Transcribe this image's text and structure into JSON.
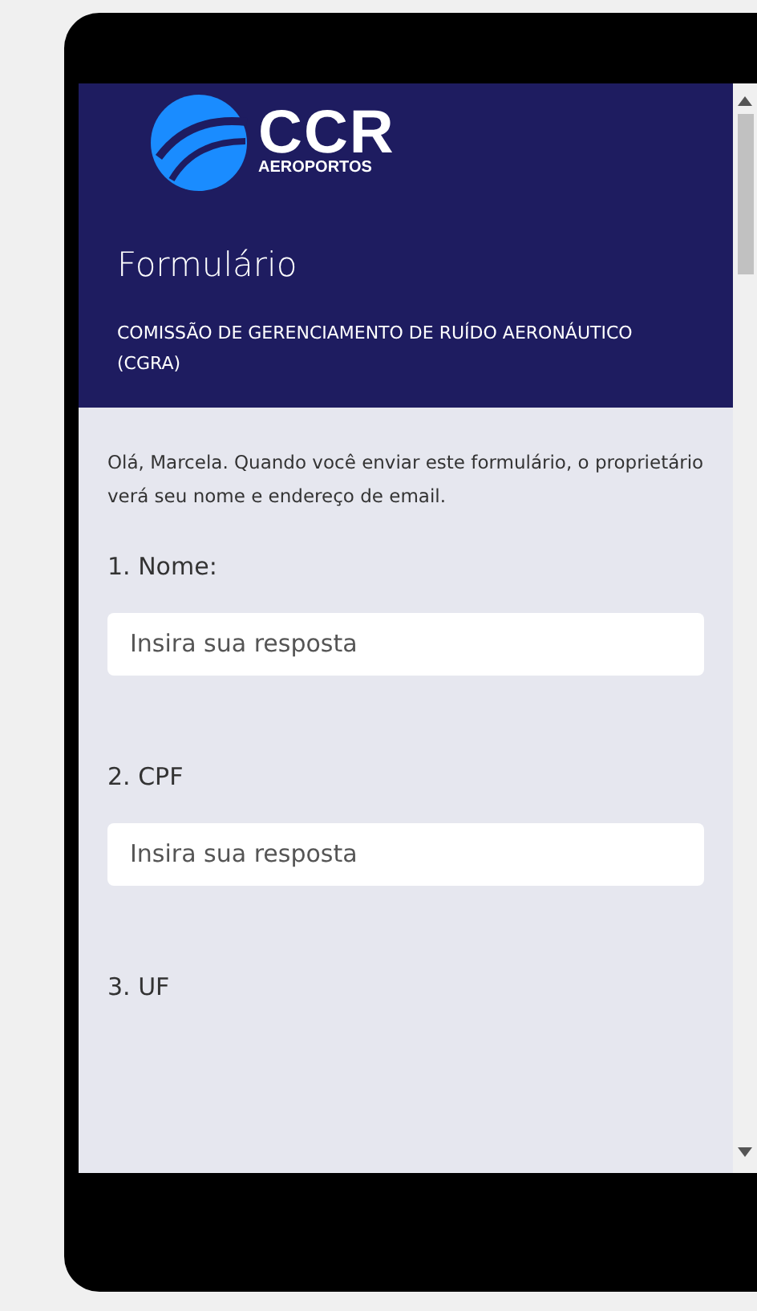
{
  "logo": {
    "name": "CCR",
    "subtitle": "AEROPORTOS"
  },
  "header": {
    "title": "Formulário",
    "subtitle": "COMISSÃO DE GERENCIAMENTO DE RUÍDO AERONÁUTICO (CGRA)"
  },
  "notice": "Olá, Marcela. Quando você enviar este formulário, o proprietário verá seu nome e endereço de email.",
  "questions": [
    {
      "label": "1. Nome:",
      "placeholder": "Insira sua resposta"
    },
    {
      "label": "2. CPF",
      "placeholder": "Insira sua resposta"
    },
    {
      "label": "3. UF"
    }
  ]
}
